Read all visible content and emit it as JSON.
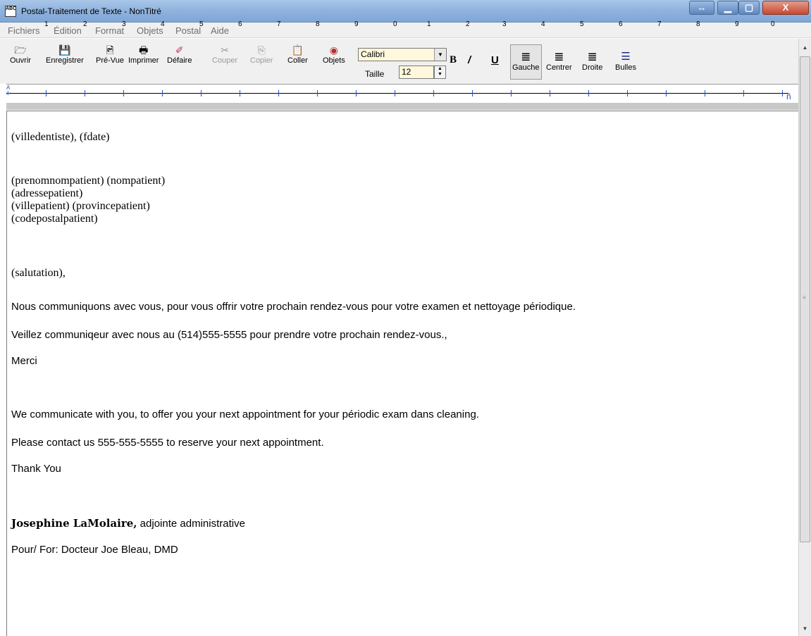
{
  "window": {
    "title": "Postal-Traitement de Texte - NonTitré",
    "icon_label": "ABC",
    "controls": {
      "resize": "↔",
      "minimize": "▁",
      "maximize": "▢",
      "close": "X"
    }
  },
  "menu": [
    "Fichiers",
    "Édition",
    "Format",
    "Objets",
    "Postal",
    "Aide"
  ],
  "toolbar": {
    "buttons": [
      {
        "label": "Ouvrir",
        "icon": "folder-open-icon",
        "glyph": "🗁",
        "enabled": true
      },
      {
        "label": "Enregistrer",
        "icon": "floppy-disk-icon",
        "glyph": "💾",
        "enabled": true
      },
      {
        "label": "Pré-Vue",
        "icon": "print-preview-icon",
        "glyph": "🖻",
        "enabled": true
      },
      {
        "label": "Imprimer",
        "icon": "printer-icon",
        "glyph": "🖶",
        "enabled": true
      },
      {
        "label": "Défaire",
        "icon": "undo-brush-icon",
        "glyph": "✐",
        "enabled": true
      },
      {
        "label": "Couper",
        "icon": "scissors-icon",
        "glyph": "✂",
        "enabled": false
      },
      {
        "label": "Copier",
        "icon": "copy-icon",
        "glyph": "⎘",
        "enabled": false
      },
      {
        "label": "Coller",
        "icon": "paste-icon",
        "glyph": "📋",
        "enabled": true
      },
      {
        "label": "Objets",
        "icon": "objects-icon",
        "glyph": "◉",
        "enabled": true
      }
    ],
    "font": {
      "value": "Calibri"
    },
    "size": {
      "label": "Taille",
      "value": "12"
    },
    "format": {
      "bold": "B",
      "italic": "/",
      "underline": "U"
    },
    "align": [
      {
        "label": "Gauche",
        "icon": "align-left-icon",
        "glyph": "≣",
        "pressed": true
      },
      {
        "label": "Centrer",
        "icon": "align-center-icon",
        "glyph": "≣",
        "pressed": false
      },
      {
        "label": "Droite",
        "icon": "align-right-icon",
        "glyph": "≣",
        "pressed": false
      },
      {
        "label": "Bulles",
        "icon": "bullets-icon",
        "glyph": "☰",
        "pressed": false
      }
    ]
  },
  "ruler": {
    "numbers": [
      "1",
      "2",
      "3",
      "4",
      "5",
      "6",
      "7",
      "8",
      "9",
      "0",
      "1",
      "2",
      "3",
      "4",
      "5",
      "6",
      "7",
      "8",
      "9",
      "0"
    ],
    "left_marker_top": "A",
    "left_marker_bottom": "é",
    "right_marker": "ñ"
  },
  "document": {
    "date_line": "(villedentiste), (fdate)",
    "address": [
      "(prenomnompatient) (nompatient)",
      "(adressepatient)",
      "(villepatient) (provincepatient)",
      "(codepostalpatient)"
    ],
    "salutation": "(salutation),",
    "fr_body1": "Nous communiquons avec vous,  pour  vous offrir votre prochain rendez-vous pour votre examen et nettoyage périodique.",
    "fr_body2": "Veillez communiqeur avec nous au (514)555-5555 pour prendre votre prochain rendez-vous.,",
    "fr_thanks": "Merci",
    "en_body1": "We communicate with you, to offer you your next appointment for your périodic exam dans cleaning.",
    "en_body2": "Please contact us 555-555-5555 to reserve your next appointment.",
    "en_thanks": "Thank You",
    "signature_name": "Josephine LaMolaire,",
    "signature_title": " adjointe administrative",
    "pour_line": "Pour/ For:  Docteur Joe Bleau, DMD"
  }
}
